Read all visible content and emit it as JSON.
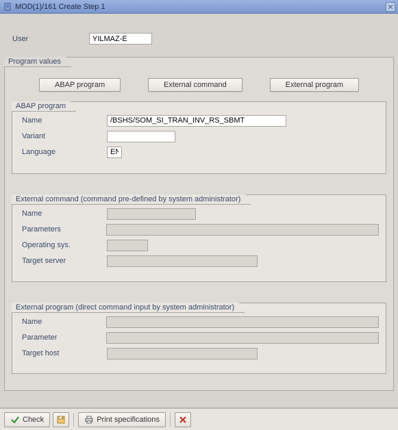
{
  "title": "MOD(1)/161 Create Step 1",
  "user": {
    "label": "User",
    "value": "YILMAZ-E"
  },
  "groups": {
    "program_values": "Program values",
    "abap": "ABAP program",
    "ext_cmd": "External command (command pre-defined by system administrator)",
    "ext_prog": "External program (direct command input by system administrator)"
  },
  "buttons": {
    "abap": "ABAP program",
    "ext_cmd": "External command",
    "ext_prog": "External program"
  },
  "abap": {
    "name_label": "Name",
    "name_value": "/BSHS/SOM_SI_TRAN_INV_RS_SBMT",
    "variant_label": "Variant",
    "variant_value": "",
    "language_label": "Language",
    "language_value": "EN"
  },
  "extcmd": {
    "name_label": "Name",
    "name_value": "",
    "params_label": "Parameters",
    "params_value": "",
    "os_label": "Operating sys.",
    "os_value": "",
    "target_label": "Target server",
    "target_value": ""
  },
  "extprog": {
    "name_label": "Name",
    "name_value": "",
    "param_label": "Parameter",
    "param_value": "",
    "host_label": "Target host",
    "host_value": ""
  },
  "toolbar": {
    "check": "Check",
    "print_spec": "Print specifications"
  }
}
